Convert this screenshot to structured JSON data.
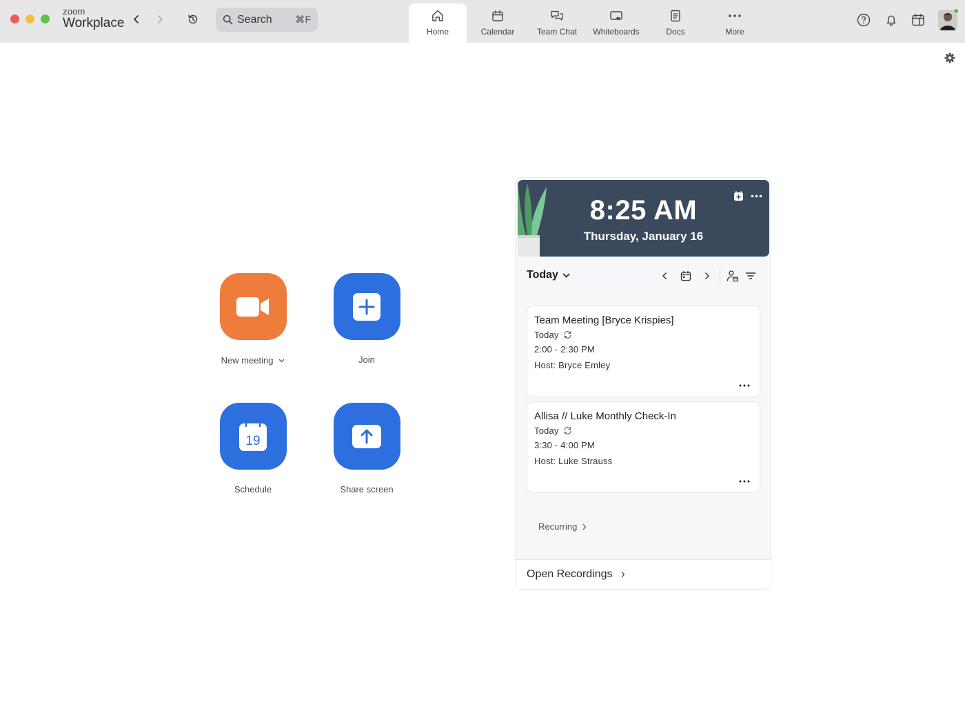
{
  "app": {
    "brand_small": "zoom",
    "brand_large": "Workplace"
  },
  "search": {
    "label": "Search",
    "shortcut": "⌘F"
  },
  "tabs": [
    {
      "label": "Home",
      "icon": "home-icon",
      "active": true
    },
    {
      "label": "Calendar",
      "icon": "calendar-icon",
      "active": false
    },
    {
      "label": "Team Chat",
      "icon": "chat-icon",
      "active": false
    },
    {
      "label": "Whiteboards",
      "icon": "whiteboard-icon",
      "active": false
    },
    {
      "label": "Docs",
      "icon": "docs-icon",
      "active": false
    },
    {
      "label": "More",
      "icon": "more-icon",
      "active": false
    }
  ],
  "actions": {
    "new_meeting": "New meeting",
    "join": "Join",
    "schedule": "Schedule",
    "schedule_day": "19",
    "share_screen": "Share screen"
  },
  "clock": {
    "time": "8:25 AM",
    "date": "Thursday, January 16"
  },
  "calendar": {
    "range_label": "Today",
    "events": [
      {
        "title": "Team Meeting [Bryce Krispies]",
        "day": "Today",
        "time": "2:00 - 2:30 PM",
        "host": "Host: Bryce Emley"
      },
      {
        "title": "Allisa // Luke Monthly Check-In",
        "day": "Today",
        "time": "3:30 - 4:00 PM",
        "host": "Host: Luke Strauss"
      }
    ],
    "recurring_label": "Recurring",
    "open_recordings_label": "Open Recordings"
  },
  "colors": {
    "new_meeting_tile": "#ee7d3c",
    "blue_tile": "#2e6fdf",
    "clock_card": "#3a4a5c",
    "presence_online": "#4fbf3c"
  }
}
